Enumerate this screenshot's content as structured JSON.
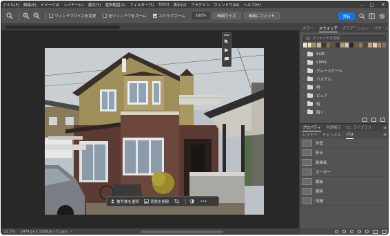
{
  "menubar": {
    "items": [
      "ァイル(F)",
      "編集(E)",
      "イメージ(I)",
      "レイヤー(L)",
      "書式(Y)",
      "選択範囲(S)",
      "フィルター(T)",
      "3D(D)",
      "表示(V)",
      "プラグイン",
      "ウィンドウ(W)",
      "ヘルプ(H)"
    ]
  },
  "options": {
    "resize_windows_label": "ウィンドウサイズを変更",
    "zoom_all_label": "全ウィンドウをズーム",
    "scrubby_zoom_label": "スクラブズーム",
    "zoom_value": "100%",
    "fit_screen_label": "画面サイズ",
    "fill_screen_label": "画面にフィット",
    "share_label": "共有"
  },
  "canvas": {
    "contextbar": {
      "select_subject": "被写体を選択",
      "remove_background": "背景を削除",
      "more": "•••"
    }
  },
  "status": {
    "zoom": "22.7%",
    "doc_info": "1479 px x 1109 px (72 ppi)"
  },
  "swatches_panel": {
    "tabs": [
      "カラー",
      "スウォッチ",
      "グラデーション",
      "パターン"
    ],
    "active_tab": "スウォッチ",
    "search_placeholder": "スウォッチを検索",
    "colors": [
      "#e8e2c8",
      "#f2e7b0",
      "#a88a5a",
      "#c8b89a",
      "#4a3a2a",
      "#8a6a4a",
      "#6a5038",
      "#3a2e24",
      "#b89a7a",
      "#d8c4a8",
      "#2a2a2a",
      "#7a5a3c",
      "#9a7a5a",
      "#5a4634",
      "#c2a47e",
      "#e0d2b8",
      "#b08a62",
      "#8c6c4c"
    ],
    "folders": [
      "RGB",
      "CMYK",
      "グレースケール",
      "パステル",
      "明",
      "ピュア",
      "暗",
      "暗く"
    ]
  },
  "properties_panel": {
    "tabs": [
      "プロパティ",
      "色調補正",
      "CC ライブラリ"
    ]
  },
  "layers_panel": {
    "tabs": [
      "レイヤー",
      "チャンネル",
      "パス"
    ],
    "active_tab": "パス",
    "paths": [
      "外壁",
      "軒天",
      "破風板",
      "ボーダー",
      "幕板",
      "霧除",
      "雨樋"
    ]
  }
}
